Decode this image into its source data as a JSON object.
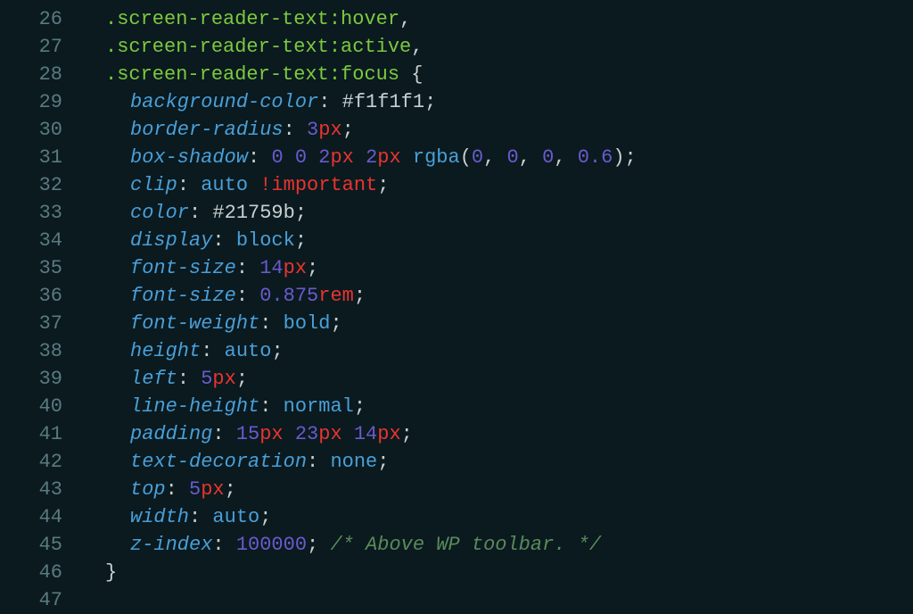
{
  "lineNumbers": [
    "26",
    "27",
    "28",
    "29",
    "30",
    "31",
    "32",
    "33",
    "34",
    "35",
    "36",
    "37",
    "38",
    "39",
    "40",
    "41",
    "42",
    "43",
    "44",
    "45",
    "46",
    "47"
  ],
  "lines": [
    {
      "indent": 1,
      "tokens": [
        {
          "cls": "tok-selector",
          "t": ".screen-reader-text"
        },
        {
          "cls": "tok-pseudo",
          "t": ":hover"
        },
        {
          "cls": "tok-comma",
          "t": ","
        }
      ]
    },
    {
      "indent": 1,
      "tokens": [
        {
          "cls": "tok-selector",
          "t": ".screen-reader-text"
        },
        {
          "cls": "tok-pseudo",
          "t": ":active"
        },
        {
          "cls": "tok-comma",
          "t": ","
        }
      ]
    },
    {
      "indent": 1,
      "tokens": [
        {
          "cls": "tok-selector",
          "t": ".screen-reader-text"
        },
        {
          "cls": "tok-pseudo",
          "t": ":focus"
        },
        {
          "cls": "tok-brace",
          "t": " {"
        }
      ]
    },
    {
      "indent": 2,
      "tokens": [
        {
          "cls": "tok-property",
          "t": "background-color"
        },
        {
          "cls": "tok-colon",
          "t": ": "
        },
        {
          "cls": "tok-hex",
          "t": "#f1f1f1"
        },
        {
          "cls": "tok-semi",
          "t": ";"
        }
      ]
    },
    {
      "indent": 2,
      "tokens": [
        {
          "cls": "tok-property",
          "t": "border-radius"
        },
        {
          "cls": "tok-colon",
          "t": ": "
        },
        {
          "cls": "tok-number",
          "t": "3"
        },
        {
          "cls": "tok-unit",
          "t": "px"
        },
        {
          "cls": "tok-semi",
          "t": ";"
        }
      ]
    },
    {
      "indent": 2,
      "tokens": [
        {
          "cls": "tok-property",
          "t": "box-shadow"
        },
        {
          "cls": "tok-colon",
          "t": ": "
        },
        {
          "cls": "tok-number",
          "t": "0"
        },
        {
          "cls": "tok-hex",
          "t": " "
        },
        {
          "cls": "tok-number",
          "t": "0"
        },
        {
          "cls": "tok-hex",
          "t": " "
        },
        {
          "cls": "tok-number",
          "t": "2"
        },
        {
          "cls": "tok-unit",
          "t": "px"
        },
        {
          "cls": "tok-hex",
          "t": " "
        },
        {
          "cls": "tok-number",
          "t": "2"
        },
        {
          "cls": "tok-unit",
          "t": "px"
        },
        {
          "cls": "tok-hex",
          "t": " "
        },
        {
          "cls": "tok-func",
          "t": "rgba"
        },
        {
          "cls": "tok-paren",
          "t": "("
        },
        {
          "cls": "tok-number",
          "t": "0"
        },
        {
          "cls": "tok-comma",
          "t": ", "
        },
        {
          "cls": "tok-number",
          "t": "0"
        },
        {
          "cls": "tok-comma",
          "t": ", "
        },
        {
          "cls": "tok-number",
          "t": "0"
        },
        {
          "cls": "tok-comma",
          "t": ", "
        },
        {
          "cls": "tok-number",
          "t": "0.6"
        },
        {
          "cls": "tok-paren",
          "t": ")"
        },
        {
          "cls": "tok-semi",
          "t": ";"
        }
      ]
    },
    {
      "indent": 2,
      "tokens": [
        {
          "cls": "tok-property",
          "t": "clip"
        },
        {
          "cls": "tok-colon",
          "t": ": "
        },
        {
          "cls": "tok-value",
          "t": "auto "
        },
        {
          "cls": "tok-important",
          "t": "!important"
        },
        {
          "cls": "tok-semi",
          "t": ";"
        }
      ]
    },
    {
      "indent": 2,
      "tokens": [
        {
          "cls": "tok-property",
          "t": "color"
        },
        {
          "cls": "tok-colon",
          "t": ": "
        },
        {
          "cls": "tok-hex",
          "t": "#21759b"
        },
        {
          "cls": "tok-semi",
          "t": ";"
        }
      ]
    },
    {
      "indent": 2,
      "tokens": [
        {
          "cls": "tok-property",
          "t": "display"
        },
        {
          "cls": "tok-colon",
          "t": ": "
        },
        {
          "cls": "tok-value",
          "t": "block"
        },
        {
          "cls": "tok-semi",
          "t": ";"
        }
      ]
    },
    {
      "indent": 2,
      "tokens": [
        {
          "cls": "tok-property",
          "t": "font-size"
        },
        {
          "cls": "tok-colon",
          "t": ": "
        },
        {
          "cls": "tok-number",
          "t": "14"
        },
        {
          "cls": "tok-unit",
          "t": "px"
        },
        {
          "cls": "tok-semi",
          "t": ";"
        }
      ]
    },
    {
      "indent": 2,
      "tokens": [
        {
          "cls": "tok-property",
          "t": "font-size"
        },
        {
          "cls": "tok-colon",
          "t": ": "
        },
        {
          "cls": "tok-number",
          "t": "0.875"
        },
        {
          "cls": "tok-unit",
          "t": "rem"
        },
        {
          "cls": "tok-semi",
          "t": ";"
        }
      ]
    },
    {
      "indent": 2,
      "tokens": [
        {
          "cls": "tok-property",
          "t": "font-weight"
        },
        {
          "cls": "tok-colon",
          "t": ": "
        },
        {
          "cls": "tok-value",
          "t": "bold"
        },
        {
          "cls": "tok-semi",
          "t": ";"
        }
      ]
    },
    {
      "indent": 2,
      "tokens": [
        {
          "cls": "tok-property",
          "t": "height"
        },
        {
          "cls": "tok-colon",
          "t": ": "
        },
        {
          "cls": "tok-value",
          "t": "auto"
        },
        {
          "cls": "tok-semi",
          "t": ";"
        }
      ]
    },
    {
      "indent": 2,
      "tokens": [
        {
          "cls": "tok-property",
          "t": "left"
        },
        {
          "cls": "tok-colon",
          "t": ": "
        },
        {
          "cls": "tok-number",
          "t": "5"
        },
        {
          "cls": "tok-unit",
          "t": "px"
        },
        {
          "cls": "tok-semi",
          "t": ";"
        }
      ]
    },
    {
      "indent": 2,
      "tokens": [
        {
          "cls": "tok-property",
          "t": "line-height"
        },
        {
          "cls": "tok-colon",
          "t": ": "
        },
        {
          "cls": "tok-value",
          "t": "normal"
        },
        {
          "cls": "tok-semi",
          "t": ";"
        }
      ]
    },
    {
      "indent": 2,
      "tokens": [
        {
          "cls": "tok-property",
          "t": "padding"
        },
        {
          "cls": "tok-colon",
          "t": ": "
        },
        {
          "cls": "tok-number",
          "t": "15"
        },
        {
          "cls": "tok-unit",
          "t": "px"
        },
        {
          "cls": "tok-hex",
          "t": " "
        },
        {
          "cls": "tok-number",
          "t": "23"
        },
        {
          "cls": "tok-unit",
          "t": "px"
        },
        {
          "cls": "tok-hex",
          "t": " "
        },
        {
          "cls": "tok-number",
          "t": "14"
        },
        {
          "cls": "tok-unit",
          "t": "px"
        },
        {
          "cls": "tok-semi",
          "t": ";"
        }
      ]
    },
    {
      "indent": 2,
      "tokens": [
        {
          "cls": "tok-property",
          "t": "text-decoration"
        },
        {
          "cls": "tok-colon",
          "t": ": "
        },
        {
          "cls": "tok-value",
          "t": "none"
        },
        {
          "cls": "tok-semi",
          "t": ";"
        }
      ]
    },
    {
      "indent": 2,
      "tokens": [
        {
          "cls": "tok-property",
          "t": "top"
        },
        {
          "cls": "tok-colon",
          "t": ": "
        },
        {
          "cls": "tok-number",
          "t": "5"
        },
        {
          "cls": "tok-unit",
          "t": "px"
        },
        {
          "cls": "tok-semi",
          "t": ";"
        }
      ]
    },
    {
      "indent": 2,
      "tokens": [
        {
          "cls": "tok-property",
          "t": "width"
        },
        {
          "cls": "tok-colon",
          "t": ": "
        },
        {
          "cls": "tok-value",
          "t": "auto"
        },
        {
          "cls": "tok-semi",
          "t": ";"
        }
      ]
    },
    {
      "indent": 2,
      "tokens": [
        {
          "cls": "tok-property",
          "t": "z-index"
        },
        {
          "cls": "tok-colon",
          "t": ": "
        },
        {
          "cls": "tok-number",
          "t": "100000"
        },
        {
          "cls": "tok-semi",
          "t": ";"
        },
        {
          "cls": "tok-comment",
          "t": " /* Above WP toolbar. */"
        }
      ]
    },
    {
      "indent": 1,
      "tokens": [
        {
          "cls": "tok-brace",
          "t": "}"
        }
      ]
    },
    {
      "indent": 0,
      "tokens": []
    }
  ]
}
